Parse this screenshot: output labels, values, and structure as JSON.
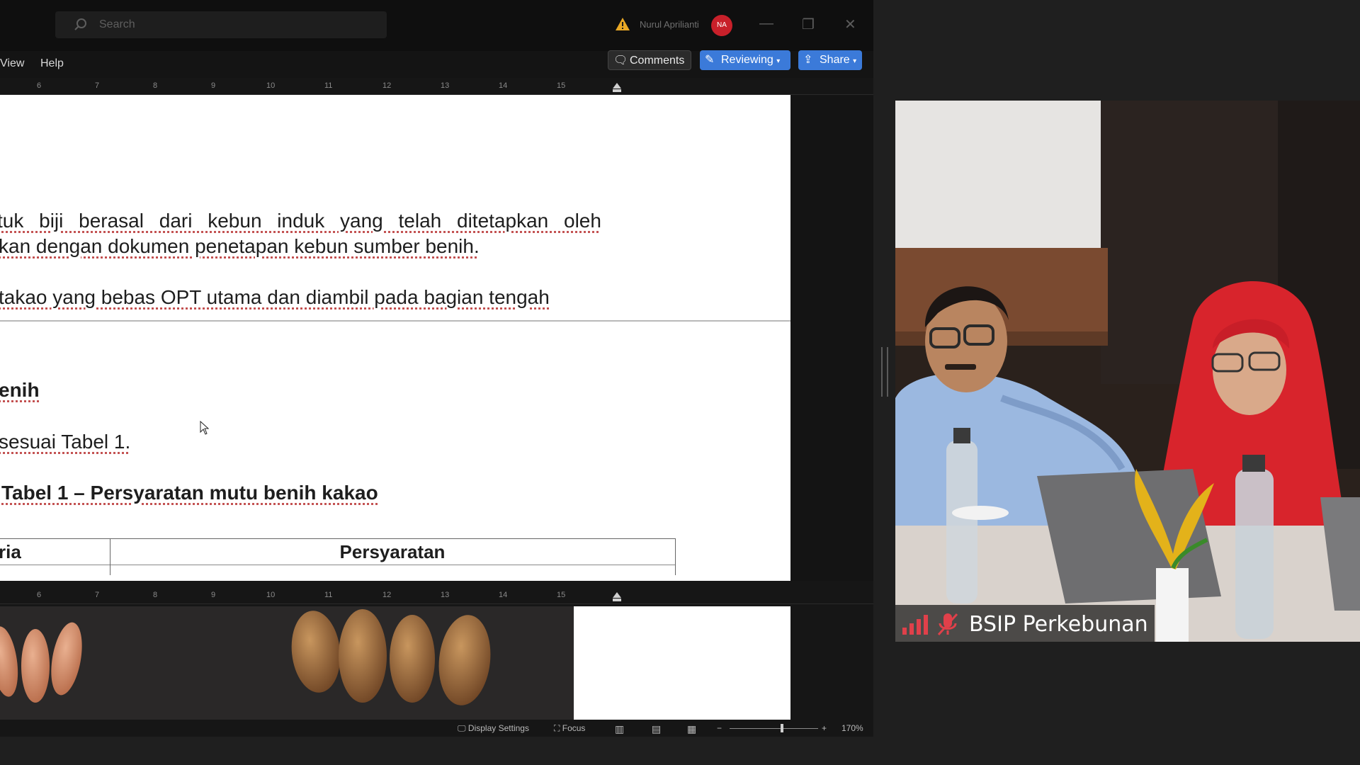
{
  "word": {
    "search_placeholder": "Search",
    "user_name": "Nurul Aprilianti",
    "user_initials": "NA",
    "menu": [
      "View",
      "Help"
    ],
    "buttons": {
      "comments": "Comments",
      "reviewing": "Reviewing",
      "share": "Share"
    },
    "ruler_numbers": [
      "6",
      "7",
      "8",
      "9",
      "10",
      "11",
      "12",
      "13",
      "14",
      "15"
    ],
    "document": {
      "line1": "tuk biji berasal dari kebun induk yang telah ditetapkan oleh",
      "line2": "kan dengan dokumen penetapan kebun sumber benih.",
      "line3": "takao yang bebas OPT utama dan diambil pada bagian tengah",
      "heading": "enih",
      "line4": "sesuai Tabel 1.",
      "table_caption": "Tabel 1 – Persyaratan mutu benih kakao",
      "table_headers": [
        "ria",
        "Persyaratan"
      ]
    },
    "status": {
      "display_settings": "Display Settings",
      "focus": "Focus",
      "zoom": "170%",
      "zoom_minus": "−",
      "zoom_plus": "+"
    }
  },
  "video": {
    "participant_name": "BSIP Perkebunan"
  },
  "colors": {
    "accent": "#3b7ad9",
    "avatar": "#c8202a",
    "mic_muted": "#e0404a"
  }
}
